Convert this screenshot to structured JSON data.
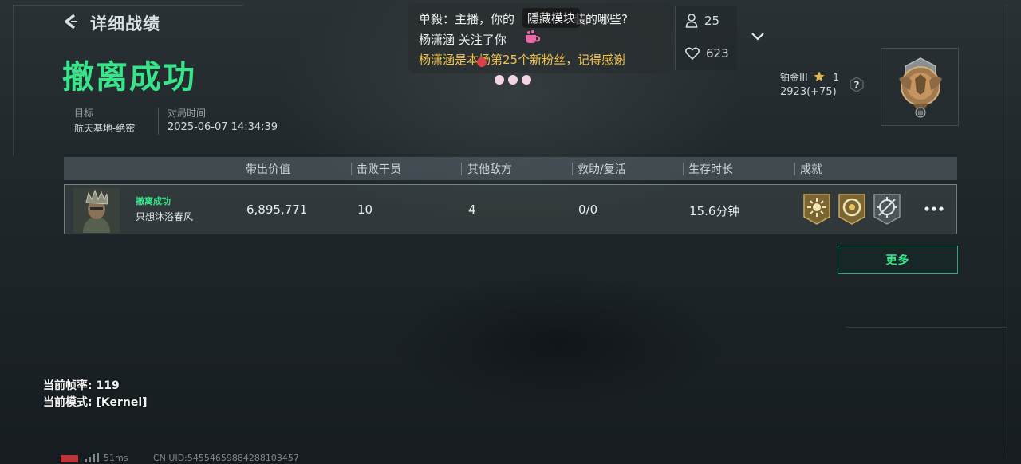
{
  "header": {
    "title": "详细战绩",
    "result": "撤离成功"
  },
  "meta": {
    "target_label": "目标",
    "target_value": "航天基地-绝密",
    "time_label": "对局时间",
    "time_value": "2025-06-07 14:34:39"
  },
  "barrage": {
    "line1": "单殺：主播，你的",
    "line1_tail": "装的哪些?",
    "line1_overlay": "隱藏模块",
    "line2": "杨潇涵  关注了你",
    "line3": "杨潇涵是本场第25个新粉丝，记得感谢"
  },
  "stream_stats": {
    "viewers": "25",
    "likes": "623"
  },
  "rank": {
    "name": "铂金III",
    "stars": "1",
    "score": "2923(+75)",
    "badge_level": "III"
  },
  "table": {
    "headers": [
      "带出价值",
      "击败干员",
      "其他敌方",
      "救助/复活",
      "生存时长",
      "成就"
    ],
    "row": {
      "status": "撤离成功",
      "player": "只想沐浴春风",
      "value": "6,895,771",
      "kills": "10",
      "other_enemies": "4",
      "assists": "0/0",
      "survival": "15.6分钟"
    }
  },
  "more_button": "更多",
  "debug": {
    "fps": "当前帧率: 119",
    "mode": "当前模式: [Kernel]"
  },
  "footer": {
    "ping": "51ms",
    "uid": "CN UID:5455465988428810345​7"
  },
  "colors": {
    "accent_green": "#39e58a",
    "gold_text": "#f0c24a"
  }
}
